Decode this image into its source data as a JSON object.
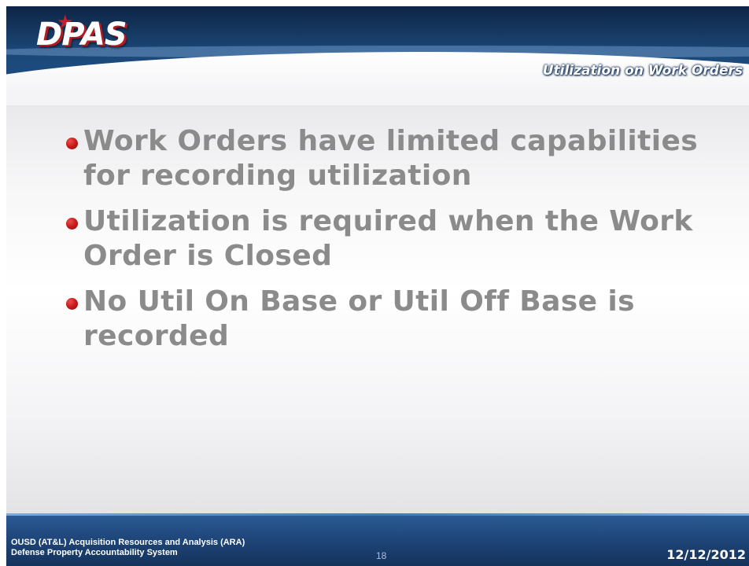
{
  "header": {
    "logo_text": "DPAS",
    "title": "Utilization on Work Orders"
  },
  "bullets": [
    {
      "line1": "Work Orders have limited capabilities",
      "line2": "for recording utilization"
    },
    {
      "line1": "Utilization is required when the Work",
      "line2": "Order is Closed"
    },
    {
      "line1": "No Util On Base or Util Off Base is",
      "line2": "recorded"
    }
  ],
  "footer": {
    "org_line1": "OUSD (AT&L) Acquisition Resources and Analysis (ARA)",
    "org_line2": "Defense Property Accountability System",
    "page_number": "18",
    "date": "12/12/2012"
  },
  "colors": {
    "header_blue": "#1c4879",
    "bullet_red": "#c71a1a",
    "body_text_gray": "#8b8b8b",
    "footer_blue": "#1d4274"
  }
}
